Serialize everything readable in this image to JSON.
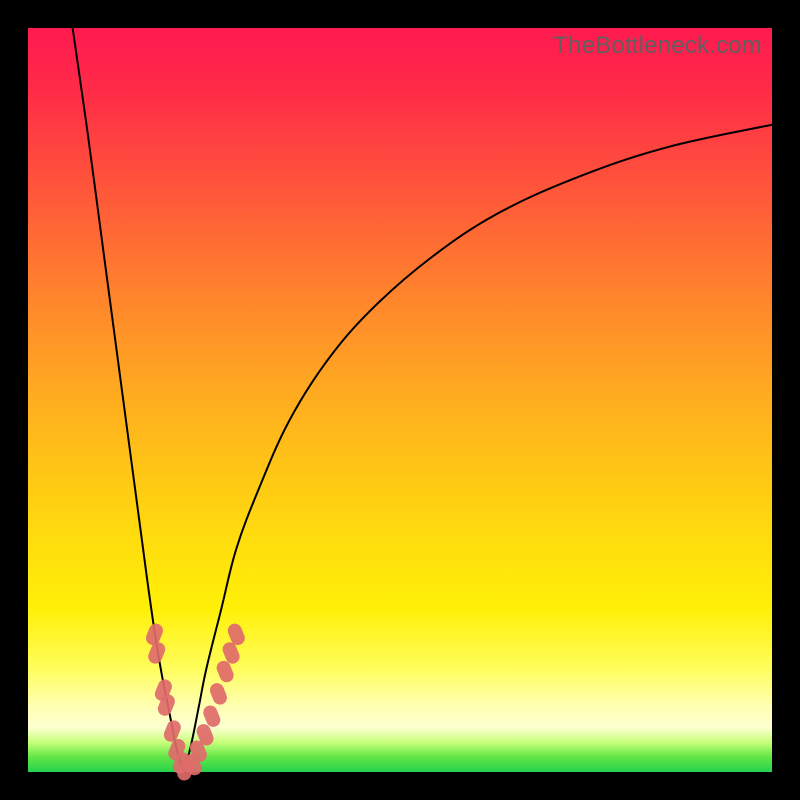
{
  "watermark": {
    "text": "TheBottleneck.com"
  },
  "chart_data": {
    "type": "line",
    "title": "",
    "xlabel": "",
    "ylabel": "",
    "xlim": [
      0,
      100
    ],
    "ylim": [
      0,
      100
    ],
    "grid": false,
    "legend": false,
    "series": [
      {
        "name": "left-branch",
        "x": [
          6,
          8,
          10,
          12,
          14,
          16,
          17,
          18,
          19,
          20,
          21
        ],
        "y": [
          100,
          86,
          71,
          56,
          41,
          26,
          19,
          13,
          8,
          3,
          0
        ]
      },
      {
        "name": "right-branch",
        "x": [
          21,
          22,
          23,
          24,
          26,
          28,
          31,
          35,
          40,
          46,
          54,
          63,
          74,
          86,
          100
        ],
        "y": [
          0,
          4,
          9,
          14,
          22,
          30,
          38,
          47,
          55,
          62,
          69,
          75,
          80,
          84,
          87
        ]
      },
      {
        "name": "left-band-markers",
        "x": [
          17.0,
          17.3,
          18.2,
          18.6,
          19.4,
          20.0,
          20.6,
          21.2
        ],
        "y": [
          18.5,
          16.0,
          11.0,
          9.0,
          5.5,
          3.0,
          1.2,
          0.3
        ]
      },
      {
        "name": "right-band-markers",
        "x": [
          22.2,
          22.9,
          23.8,
          24.7,
          25.6,
          26.5,
          27.3,
          28.0
        ],
        "y": [
          1.0,
          2.8,
          5.0,
          7.5,
          10.5,
          13.5,
          16.0,
          18.5
        ]
      }
    ],
    "colors": {
      "curve": "#000000",
      "markers": "#e06a6a"
    }
  }
}
